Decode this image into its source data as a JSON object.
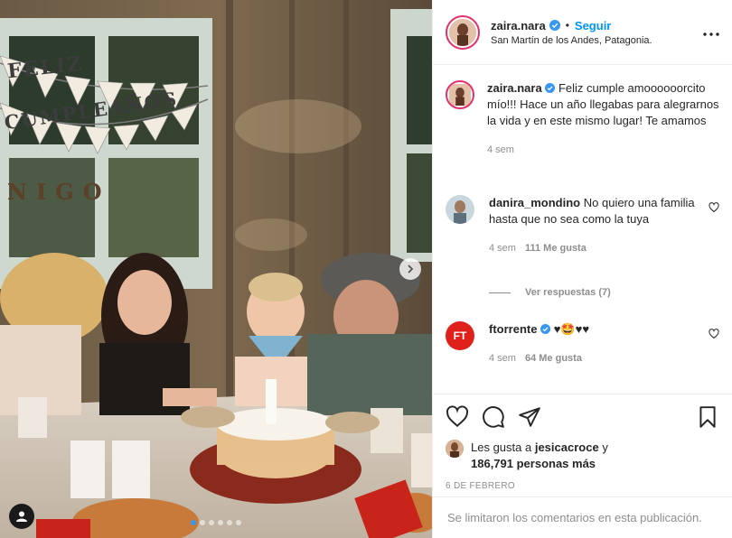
{
  "photo": {
    "banner_line1": "FELIZ",
    "banner_line2": "CUMPLEAÑOS",
    "name_letters": "NIGO"
  },
  "header": {
    "username": "zaira.nara",
    "separator": "•",
    "follow_label": "Seguir",
    "location": "San Martín de los Andes, Patagonia.",
    "more_icon": "more-dots-icon"
  },
  "caption": {
    "username": "zaira.nara",
    "text": "Feliz cumple amoooooorcito mío!!! Hace un año llegabas para alegrarnos la vida y en este mismo lugar! Te amamos",
    "time": "4 sem"
  },
  "comments": [
    {
      "username": "danira_mondino",
      "text": "No quiero una familia hasta que no sea como la tuya",
      "time": "4 sem",
      "likes": "111 Me gusta"
    },
    {
      "username": "ftorrente",
      "avatar_text": "FT",
      "text": "♥🤩♥♥",
      "time": "4 sem",
      "likes": "64 Me gusta"
    }
  ],
  "replies_label": "Ver respuestas (7)",
  "likes": {
    "prefix": "Les gusta a",
    "user": "jesicacroce",
    "joiner": "y",
    "count": "186,791 personas más"
  },
  "date": "6 DE FEBRERO",
  "comments_disabled": "Se limitaron los comentarios en esta publicación.",
  "colors": {
    "accent": "#0095f6",
    "muted": "#8e8e8e",
    "ft_avatar": "#e0201b"
  }
}
